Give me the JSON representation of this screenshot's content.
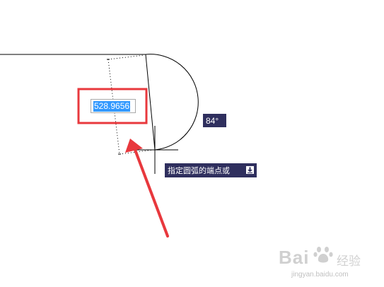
{
  "dimension_input": {
    "value": "528.9656"
  },
  "angle_tooltip": {
    "value": "84°"
  },
  "command_prompt": {
    "text": "指定圆弧的端点或"
  },
  "watermark": {
    "brand": "Bai",
    "brand_cn": "经验",
    "url": "jingyan.baidu.com"
  },
  "colors": {
    "highlight_box": "#e8383d",
    "arrow": "#e8383d",
    "tooltip_bg": "#2f2f5e",
    "selection": "#3399ff",
    "geometry": "#000000"
  },
  "icons": {
    "prompt_dropdown": "chevron-down-icon"
  }
}
